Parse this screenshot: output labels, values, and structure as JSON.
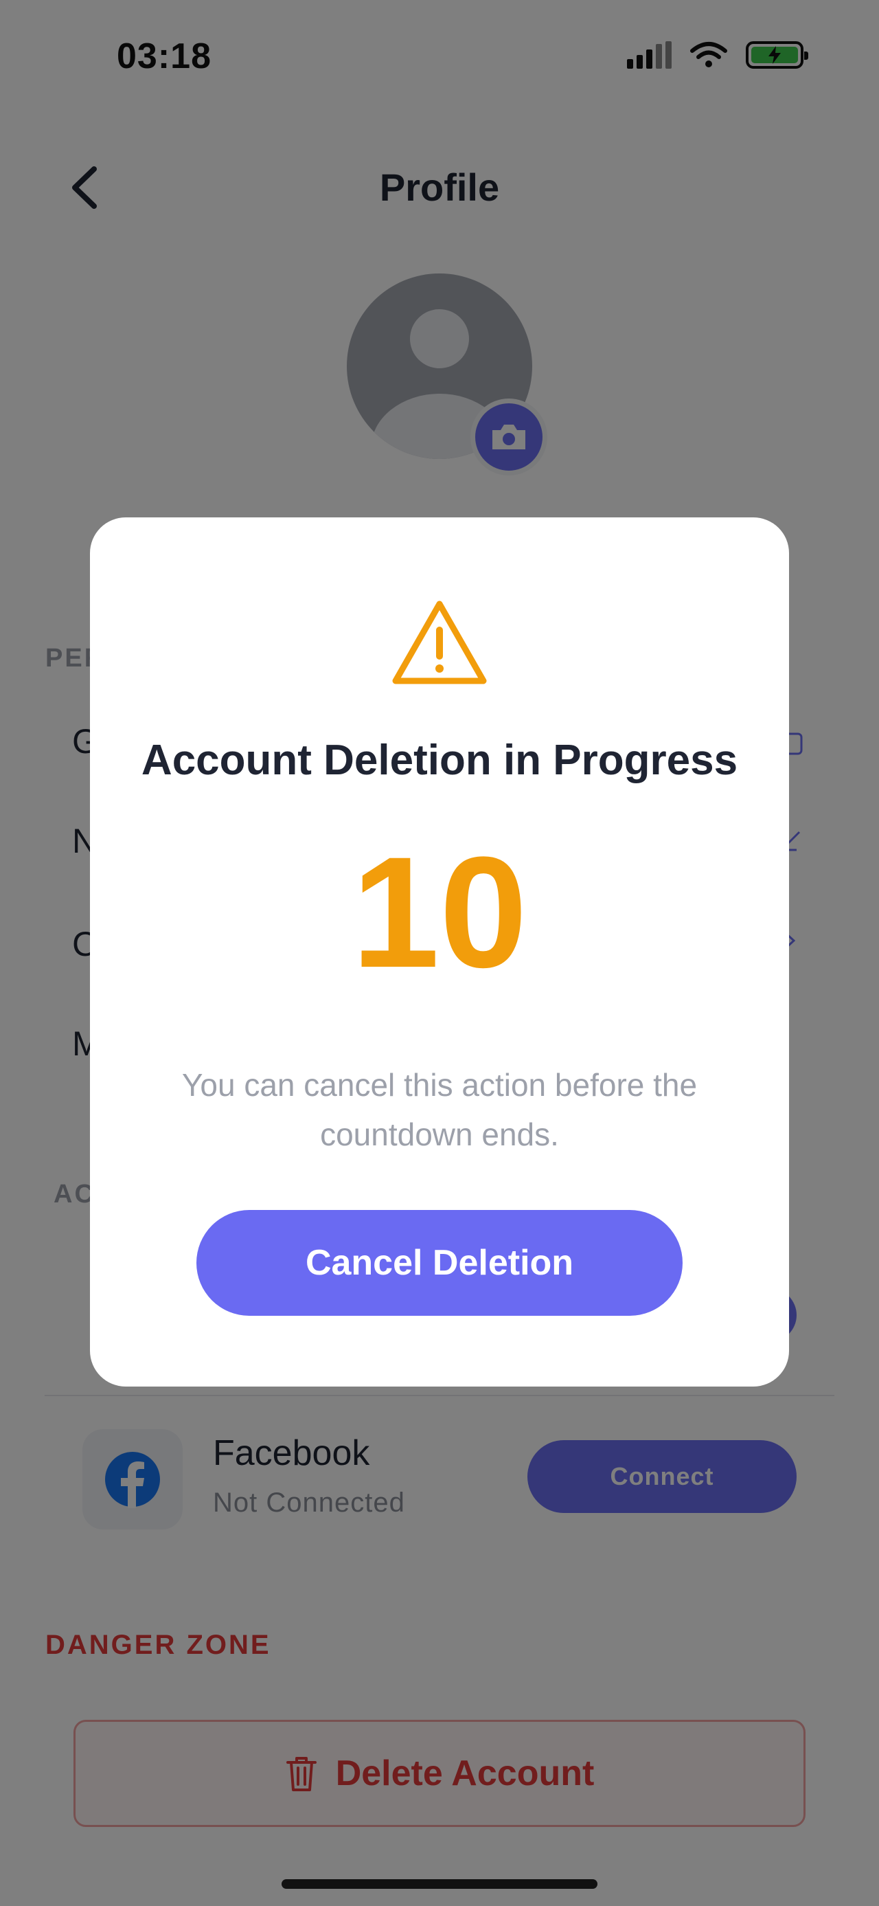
{
  "status_bar": {
    "time": "03:18"
  },
  "header": {
    "title": "Profile"
  },
  "sections": {
    "personal_partial": "PER",
    "accounts_partial": "AC",
    "danger": "DANGER ZONE"
  },
  "rows_partial": [
    "G",
    "N",
    "C",
    "M"
  ],
  "social": {
    "facebook": {
      "name": "Facebook",
      "status": "Not Connected",
      "button": "Connect"
    }
  },
  "danger_zone": {
    "delete_label": "Delete Account"
  },
  "modal": {
    "title": "Account Deletion in Progress",
    "countdown": "10",
    "message": "You can cancel this action before the countdown ends.",
    "cancel_label": "Cancel Deletion"
  },
  "colors": {
    "accent": "#6a6ff0",
    "warning": "#f29d0b",
    "danger": "#e23b3b",
    "overlay": "rgba(0,0,0,0.5)"
  }
}
